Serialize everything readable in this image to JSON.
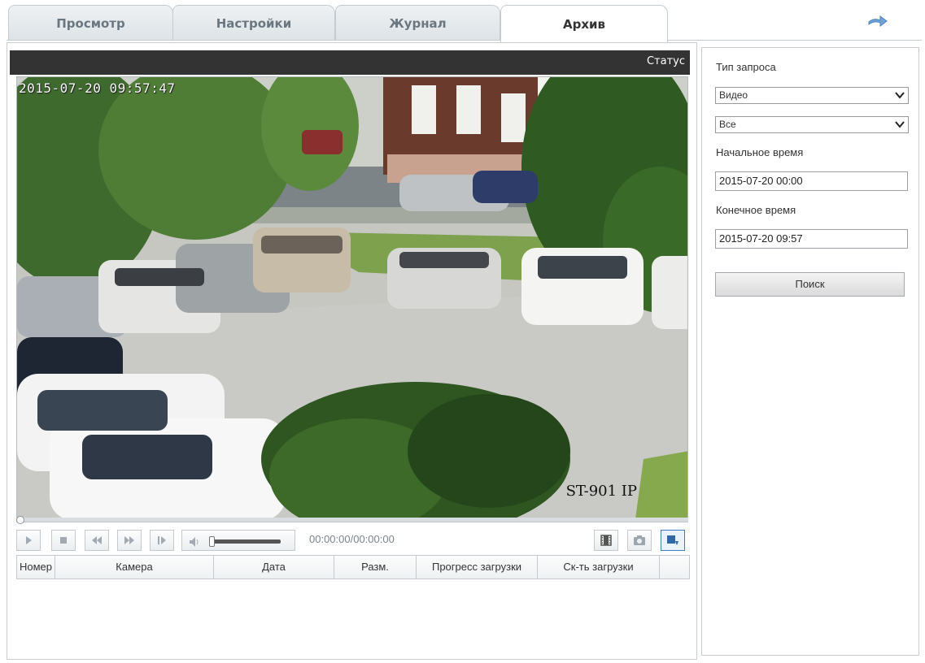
{
  "tabs": [
    {
      "label": "Просмотр",
      "active": false
    },
    {
      "label": "Настройки",
      "active": false
    },
    {
      "label": "Журнал",
      "active": false
    },
    {
      "label": "Архив",
      "active": true
    }
  ],
  "exit_icon": "arrow-right-icon",
  "video": {
    "status_label": "Статус",
    "osd_timestamp": "2015-07-20 09:57:47",
    "osd_camera": "ST-901 IP",
    "timecode": "00:00:00/00:00:00",
    "seek_progress": 0,
    "volume_level": 0
  },
  "controls": {
    "play_icon": "play-icon",
    "stop_icon": "stop-icon",
    "rewind_icon": "rewind-icon",
    "fast_forward_icon": "fast-forward-icon",
    "frame_step_icon": "frame-step-icon",
    "volume_icon": "volume-icon",
    "clip_icon": "film-clip-icon",
    "snapshot_icon": "camera-icon",
    "download_icon": "download-icon"
  },
  "table": {
    "columns": [
      "Номер",
      "Камера",
      "Дата",
      "Разм.",
      "Прогресс загрузки",
      "Ск-ть загрузки",
      ""
    ]
  },
  "search_panel": {
    "query_type_label": "Тип запроса",
    "query_type_value": "Видео",
    "filter_value": "Все",
    "start_label": "Начальное время",
    "start_value": "2015-07-20 00:00",
    "end_label": "Конечное время",
    "end_value": "2015-07-20 09:57",
    "search_button": "Поиск"
  },
  "colors": {
    "status_bar": "#333333",
    "accent_border": "#3c7fc1",
    "panel_border": "#c9cdd1"
  }
}
